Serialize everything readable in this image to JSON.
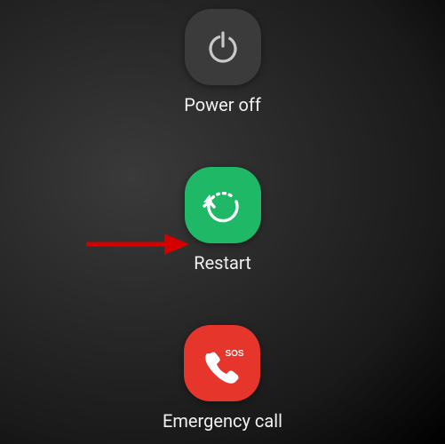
{
  "menu": {
    "powerOff": {
      "label": "Power off"
    },
    "restart": {
      "label": "Restart"
    },
    "emergency": {
      "label": "Emergency call"
    }
  },
  "colors": {
    "darkBtn": "#3b3b3b",
    "greenBtn": "#1fb866",
    "redBtn": "#e6352b"
  }
}
